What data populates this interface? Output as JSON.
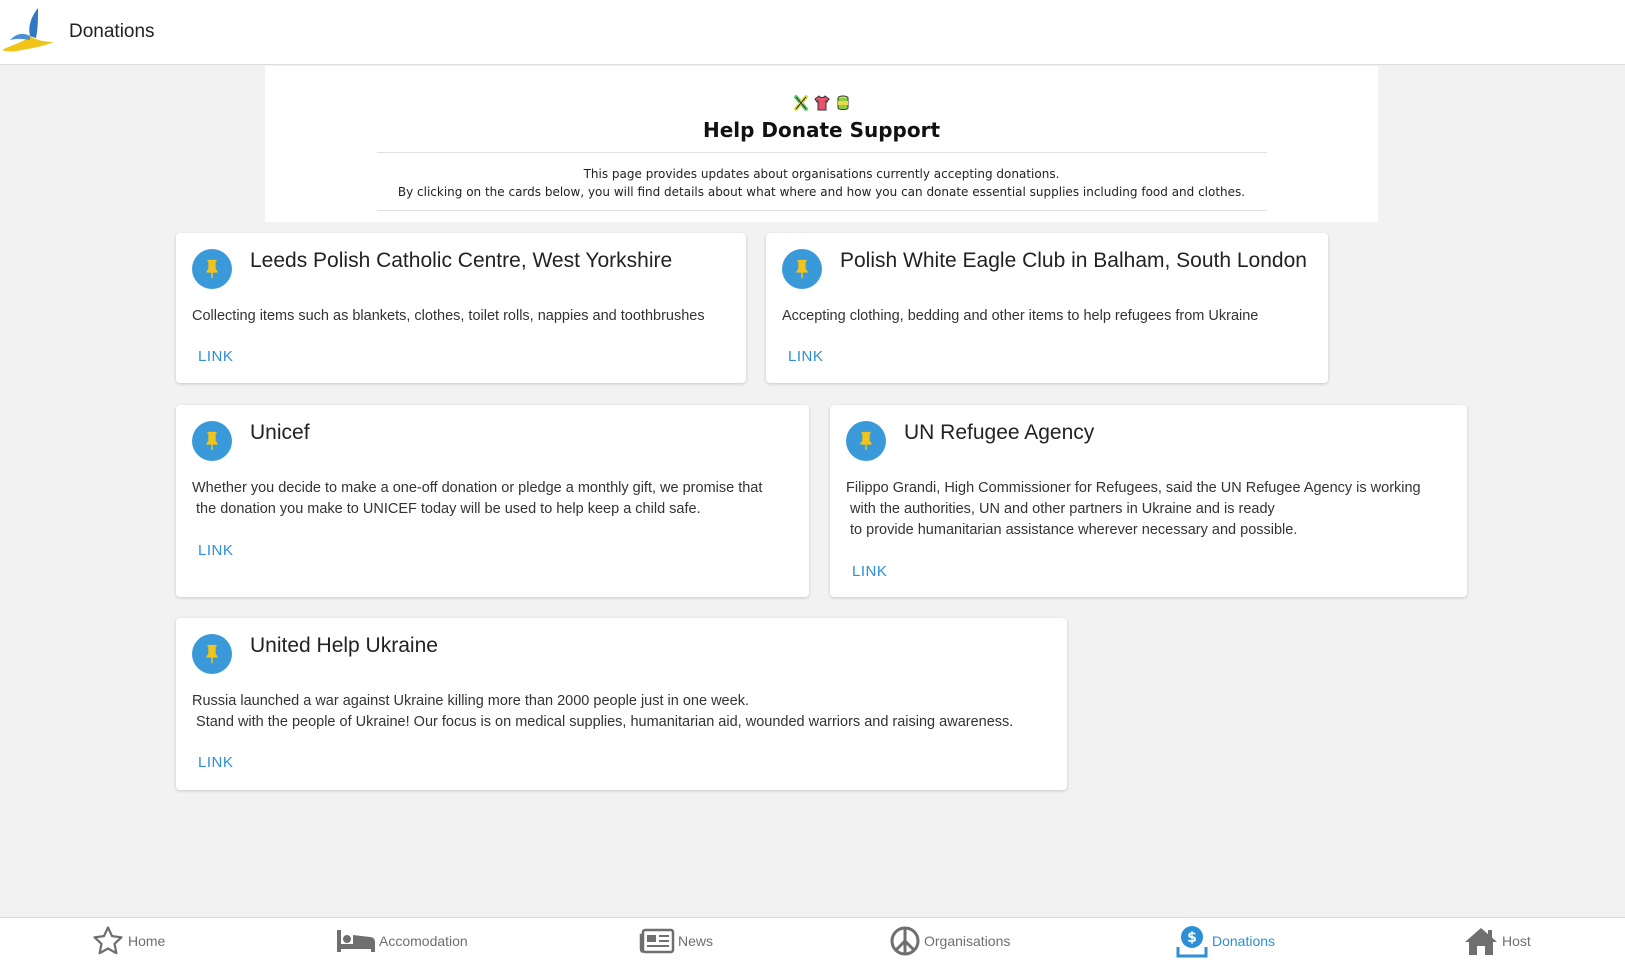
{
  "app": {
    "title": "Donations"
  },
  "banner": {
    "title": "Help Donate Support",
    "line1": "This page provides updates about organisations currently accepting donations.",
    "line2": "By clicking on the cards below, you will find details about what where and how you can donate essential supplies including food and clothes."
  },
  "cards": [
    {
      "title": "Leeds Polish Catholic Centre, West Yorkshire",
      "desc": "Collecting items such as blankets, clothes, toilet rolls, nappies and toothbrushes",
      "link": "LINK"
    },
    {
      "title": "Polish White Eagle Club in Balham, South London",
      "desc": "Accepting clothing, bedding and other items to help refugees from Ukraine",
      "link": "LINK"
    },
    {
      "title": "Unicef",
      "desc": "Whether you decide to make a one-off donation or pledge a monthly gift, we promise that\n the donation you make to UNICEF today will be used to help keep a child safe.",
      "link": "LINK"
    },
    {
      "title": "UN Refugee Agency",
      "desc": "Filippo Grandi, High Commissioner for Refugees, said the UN Refugee Agency is working\n with the authorities, UN and other partners in Ukraine and is ready\n to provide humanitarian assistance wherever necessary and possible.",
      "link": "LINK"
    },
    {
      "title": "United Help Ukraine",
      "desc": "Russia launched a war against Ukraine killing more than 2000 people just in one week.\n Stand with the people of Ukraine! Our focus is on medical supplies, humanitarian aid, wounded warriors and raising awareness.",
      "link": "LINK"
    }
  ],
  "nav": [
    {
      "label": "Home",
      "icon": "star-icon"
    },
    {
      "label": "Accomodation",
      "icon": "bed-icon"
    },
    {
      "label": "News",
      "icon": "newspaper-icon"
    },
    {
      "label": "Organisations",
      "icon": "peace-icon"
    },
    {
      "label": "Donations",
      "icon": "dollar-download-icon",
      "active": true
    },
    {
      "label": "Host",
      "icon": "house-icon"
    }
  ],
  "colors": {
    "accent": "#2d8fd5",
    "avatar": "#3a9ad9",
    "pin": "#f2c318",
    "nav_icon": "#6f6f6f"
  }
}
